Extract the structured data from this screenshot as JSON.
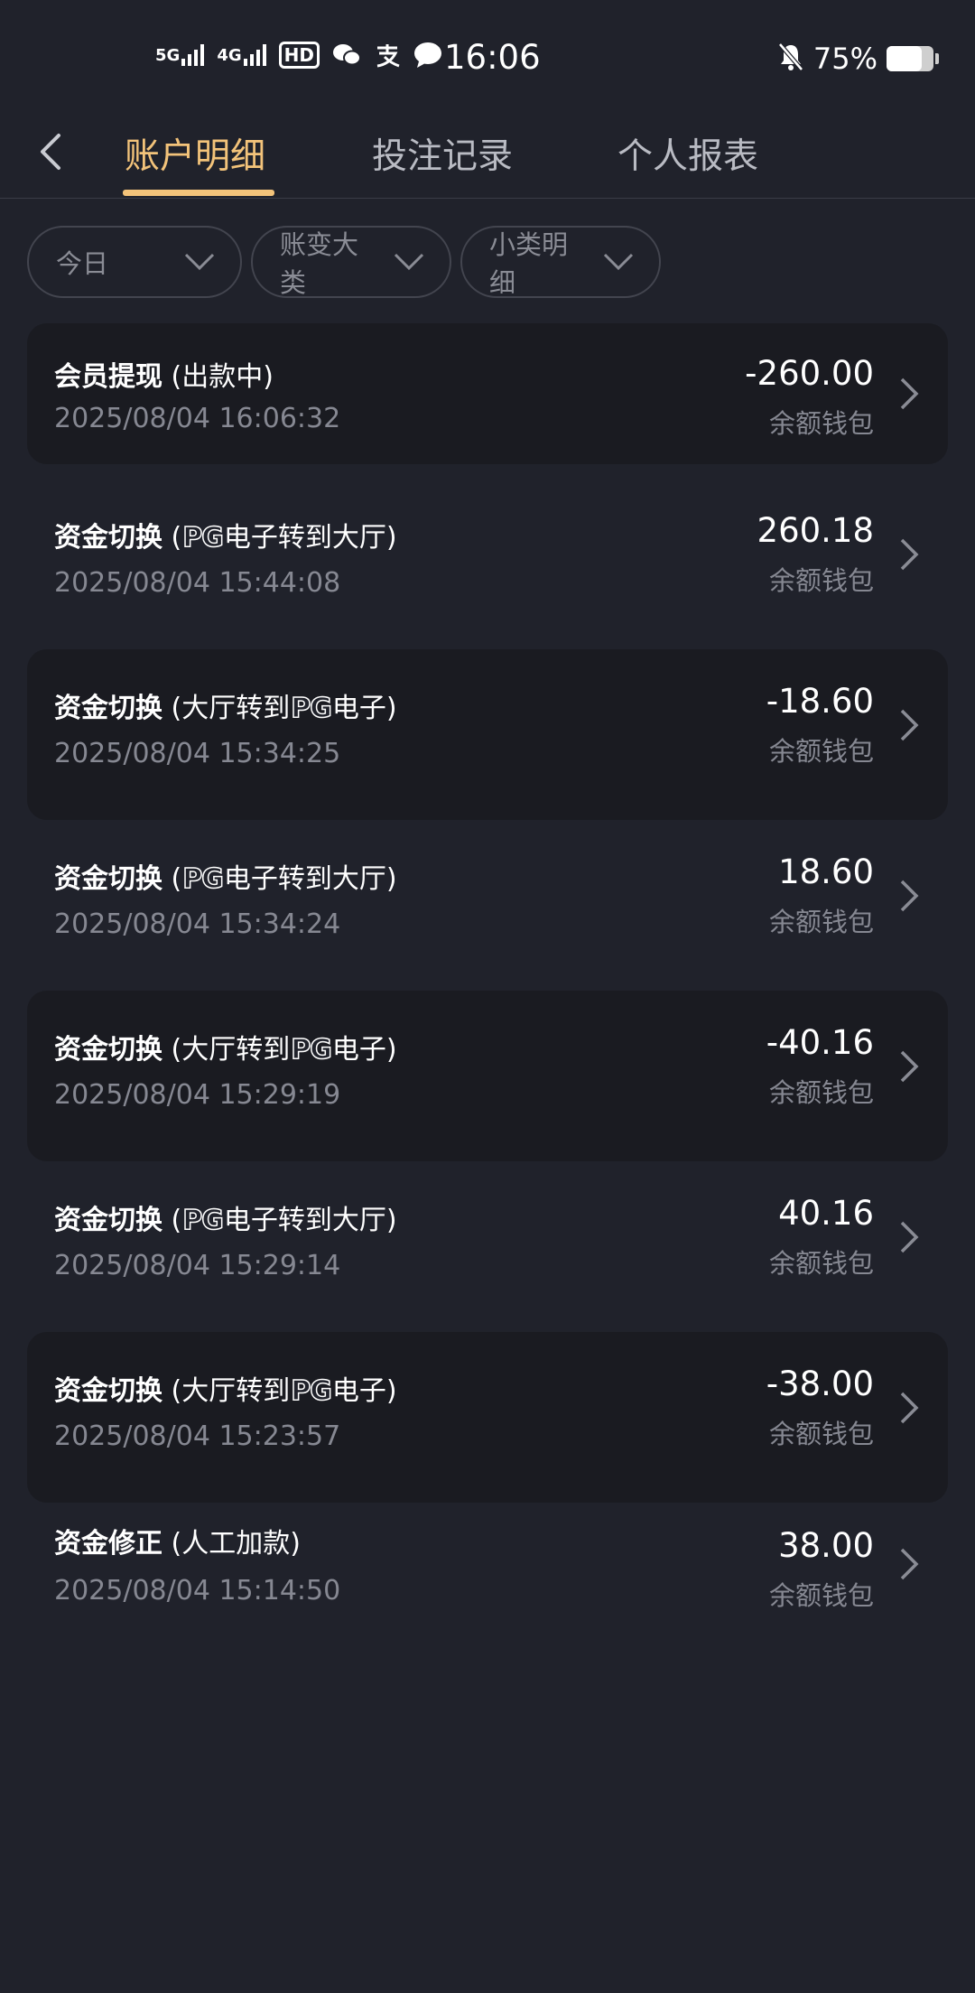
{
  "status_bar": {
    "network1": "5G",
    "network2": "4G",
    "hd_label": "HD",
    "time": "16:06",
    "battery_text": "75%",
    "battery_level": 0.75,
    "icons": [
      "signal-5g-icon",
      "signal-4g-icon",
      "hd-call-icon",
      "wechat-icon",
      "alipay-icon",
      "message-icon",
      "mute-bell-icon",
      "battery-icon"
    ]
  },
  "nav": {
    "back_icon": "chevron-left-icon",
    "tabs": [
      {
        "label": "账户明细",
        "active": true
      },
      {
        "label": "投注记录",
        "active": false
      },
      {
        "label": "个人报表",
        "active": false
      }
    ],
    "accent_color": "#f3c37a"
  },
  "filters": [
    {
      "label": "今日"
    },
    {
      "label": "账变大类"
    },
    {
      "label": "小类明细"
    }
  ],
  "records": [
    {
      "type": "会员提现",
      "detail_prefix": " (出款中)",
      "pg": "",
      "detail_suffix": "",
      "time": "2025/08/04 16:06:32",
      "amount": "-260.00",
      "wallet": "余额钱包"
    },
    {
      "type": "资金切换",
      "detail_prefix": " (",
      "pg": "PG",
      "detail_suffix": "电子转到大厅)",
      "time": "2025/08/04 15:44:08",
      "amount": "260.18",
      "wallet": "余额钱包"
    },
    {
      "type": "资金切换",
      "detail_prefix": " (大厅转到",
      "pg": "PG",
      "detail_suffix": "电子)",
      "time": "2025/08/04 15:34:25",
      "amount": "-18.60",
      "wallet": "余额钱包"
    },
    {
      "type": "资金切换",
      "detail_prefix": " (",
      "pg": "PG",
      "detail_suffix": "电子转到大厅)",
      "time": "2025/08/04 15:34:24",
      "amount": "18.60",
      "wallet": "余额钱包"
    },
    {
      "type": "资金切换",
      "detail_prefix": " (大厅转到",
      "pg": "PG",
      "detail_suffix": "电子)",
      "time": "2025/08/04 15:29:19",
      "amount": "-40.16",
      "wallet": "余额钱包"
    },
    {
      "type": "资金切换",
      "detail_prefix": " (",
      "pg": "PG",
      "detail_suffix": "电子转到大厅)",
      "time": "2025/08/04 15:29:14",
      "amount": "40.16",
      "wallet": "余额钱包"
    },
    {
      "type": "资金切换",
      "detail_prefix": " (大厅转到",
      "pg": "PG",
      "detail_suffix": "电子)",
      "time": "2025/08/04 15:23:57",
      "amount": "-38.00",
      "wallet": "余额钱包"
    },
    {
      "type": "资金修正",
      "detail_prefix": " (人工加款)",
      "pg": "",
      "detail_suffix": "",
      "time": "2025/08/04 15:14:50",
      "amount": "38.00",
      "wallet": "余额钱包"
    }
  ]
}
